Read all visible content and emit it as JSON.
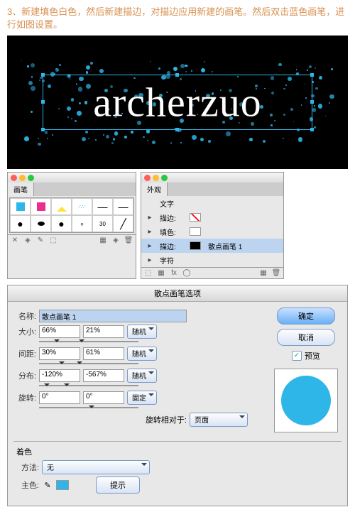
{
  "step": {
    "text": "3、新建填色白色，然后新建描边，对描边应用新建的画笔。然后双击蓝色画笔，进行如图设置。"
  },
  "canvas": {
    "text": "archerzuo"
  },
  "brushPanel": {
    "tab": "画笔",
    "row2_num": "30"
  },
  "appearPanel": {
    "tab": "外观",
    "rows": [
      {
        "label": "文字"
      },
      {
        "label": "描边:"
      },
      {
        "label": "填色:"
      },
      {
        "label": "描边:",
        "extra": "散点画笔 1",
        "sel": true
      },
      {
        "label": "字符"
      }
    ]
  },
  "dialog": {
    "title": "散点画笔选项",
    "labels": {
      "name": "名称:",
      "size": "大小:",
      "spacing": "间距:",
      "scatter": "分布:",
      "rotate": "旋转:",
      "rot_rel": "旋转相对于:",
      "tint": "着色",
      "method": "方法:",
      "main": "主色:"
    },
    "name": "散点画笔 1",
    "size": {
      "a": "66%",
      "b": "21%",
      "mode": "随机"
    },
    "spacing": {
      "a": "30%",
      "b": "61%",
      "mode": "随机"
    },
    "scatter": {
      "a": "-120%",
      "b": "-567%",
      "mode": "随机"
    },
    "rotate": {
      "a": "0°",
      "b": "0°",
      "mode": "固定"
    },
    "rot_rel": "页面",
    "method": "无",
    "hint": "提示",
    "ok": "确定",
    "cancel": "取消",
    "preview": "预览"
  }
}
